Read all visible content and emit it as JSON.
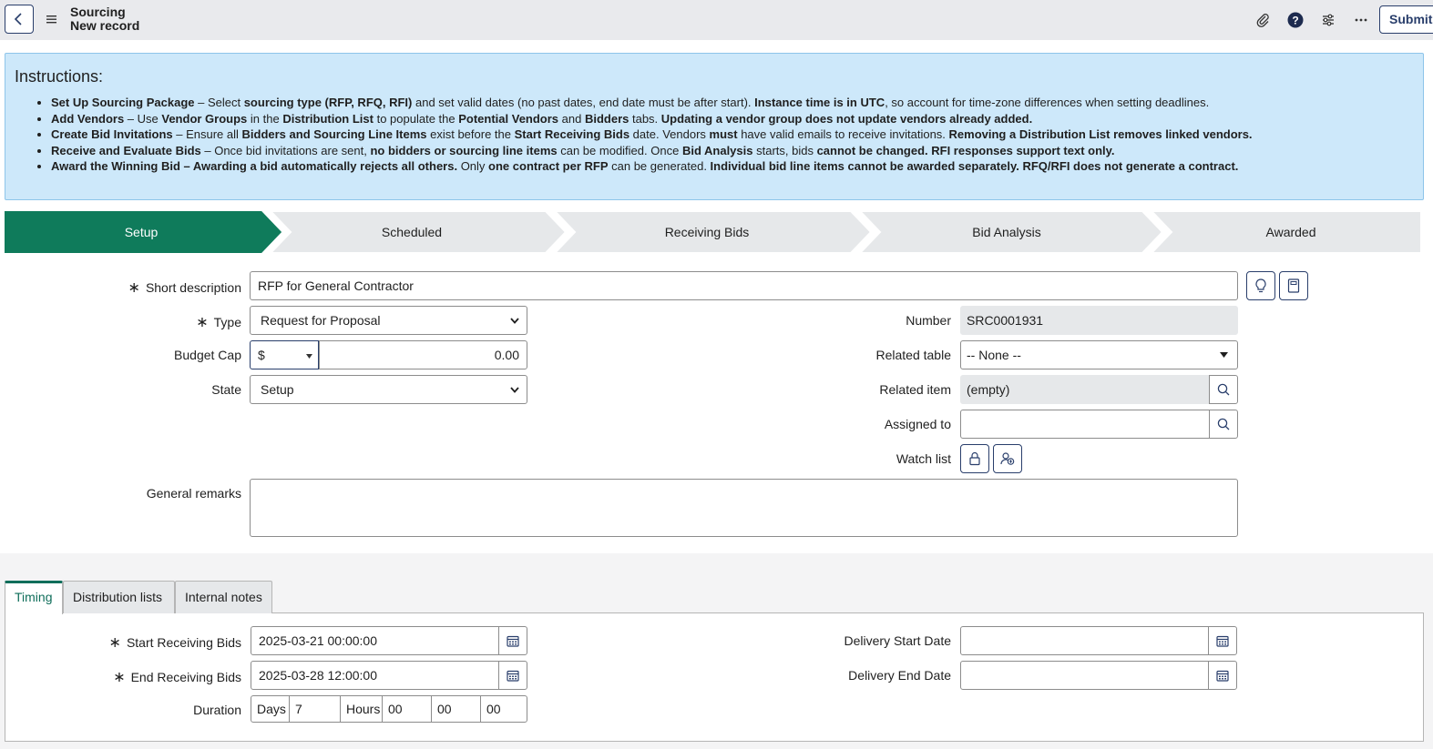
{
  "header": {
    "title": "Sourcing",
    "subtitle": "New record",
    "submit_label": "Submit",
    "icons": [
      "back-icon",
      "menu-icon",
      "attachment-icon",
      "help-icon",
      "settings-icon",
      "more-icon"
    ]
  },
  "instructions": {
    "title": "Instructions:",
    "items": [
      [
        {
          "t": "Set Up Sourcing Package",
          "b": true
        },
        {
          "t": " – Select ",
          "b": false
        },
        {
          "t": "sourcing type (RFP, RFQ, RFI)",
          "b": true
        },
        {
          "t": " and set valid dates (no past dates, end date must be after start). ",
          "b": false
        },
        {
          "t": "Instance time is in UTC",
          "b": true
        },
        {
          "t": ", so account for time-zone differences when setting deadlines.",
          "b": false
        }
      ],
      [
        {
          "t": "Add Vendors",
          "b": true
        },
        {
          "t": " – Use ",
          "b": false
        },
        {
          "t": "Vendor Groups",
          "b": true
        },
        {
          "t": " in the ",
          "b": false
        },
        {
          "t": "Distribution List",
          "b": true
        },
        {
          "t": " to populate the ",
          "b": false
        },
        {
          "t": "Potential Vendors",
          "b": true
        },
        {
          "t": " and ",
          "b": false
        },
        {
          "t": "Bidders",
          "b": true
        },
        {
          "t": " tabs. ",
          "b": false
        },
        {
          "t": "Updating a vendor group does not update vendors already added.",
          "b": true
        }
      ],
      [
        {
          "t": "Create Bid Invitations",
          "b": true
        },
        {
          "t": " – Ensure all ",
          "b": false
        },
        {
          "t": "Bidders and Sourcing Line Items",
          "b": true
        },
        {
          "t": " exist before the ",
          "b": false
        },
        {
          "t": "Start Receiving Bids",
          "b": true
        },
        {
          "t": " date. Vendors ",
          "b": false
        },
        {
          "t": "must",
          "b": true
        },
        {
          "t": " have valid emails to receive invitations. ",
          "b": false
        },
        {
          "t": "Removing a Distribution List removes linked vendors.",
          "b": true
        }
      ],
      [
        {
          "t": "Receive and Evaluate Bids",
          "b": true
        },
        {
          "t": " – Once bid invitations are sent, ",
          "b": false
        },
        {
          "t": "no bidders or sourcing line items",
          "b": true
        },
        {
          "t": " can be modified. Once ",
          "b": false
        },
        {
          "t": "Bid Analysis",
          "b": true
        },
        {
          "t": " starts, bids ",
          "b": false
        },
        {
          "t": "cannot be changed. RFI responses support text only.",
          "b": true
        }
      ],
      [
        {
          "t": "Award the Winning Bid – Awarding a bid automatically rejects all others.",
          "b": true
        },
        {
          "t": " Only ",
          "b": false
        },
        {
          "t": "one contract per RFP",
          "b": true
        },
        {
          "t": " can be generated. ",
          "b": false
        },
        {
          "t": "Individual bid line items cannot be awarded separately. RFQ/RFI does not generate a contract.",
          "b": true
        }
      ]
    ]
  },
  "process_flow": {
    "stages": [
      "Setup",
      "Scheduled",
      "Receiving Bids",
      "Bid Analysis",
      "Awarded"
    ],
    "active_stage": "Setup",
    "active_color": "#0f7b5b"
  },
  "form": {
    "short_description": {
      "label": "Short description",
      "value": "RFP for General Contractor"
    },
    "type": {
      "label": "Type",
      "value": "Request for Proposal"
    },
    "budget_cap": {
      "label": "Budget Cap",
      "currency": "$",
      "value": "0.00"
    },
    "state": {
      "label": "State",
      "value": "Setup"
    },
    "number": {
      "label": "Number",
      "value": "SRC0001931"
    },
    "related_table": {
      "label": "Related table",
      "value": "-- None --"
    },
    "related_item": {
      "label": "Related item",
      "value": "(empty)"
    },
    "assigned_to": {
      "label": "Assigned to",
      "value": ""
    },
    "watch_list": {
      "label": "Watch list"
    },
    "general_remarks": {
      "label": "General remarks",
      "value": ""
    }
  },
  "tabs": {
    "items": [
      "Timing",
      "Distribution lists",
      "Internal notes"
    ],
    "active": "Timing"
  },
  "timing": {
    "start_receiving_bids": {
      "label": "Start Receiving Bids",
      "value": "2025-03-21 00:00:00"
    },
    "end_receiving_bids": {
      "label": "End Receiving Bids",
      "value": "2025-03-28 12:00:00"
    },
    "duration": {
      "label": "Duration",
      "days_label": "Days",
      "days": "7",
      "hours_label": "Hours",
      "hours": "00",
      "minutes": "00",
      "seconds": "00"
    },
    "delivery_start_date": {
      "label": "Delivery Start Date",
      "value": ""
    },
    "delivery_end_date": {
      "label": "Delivery End Date",
      "value": ""
    }
  }
}
